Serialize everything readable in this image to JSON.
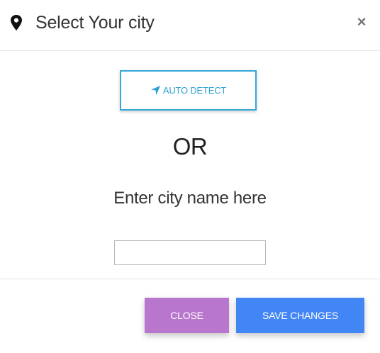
{
  "header": {
    "title": "Select Your city",
    "close_glyph": "×",
    "icon": "map-marker-icon"
  },
  "body": {
    "auto_detect_label": "AUTO DETECT",
    "auto_detect_icon": "location-arrow-icon",
    "or_text": "OR",
    "enter_city_label": "Enter city name here",
    "city_input": {
      "value": "",
      "placeholder": ""
    }
  },
  "footer": {
    "close_label": "CLOSE",
    "save_label": "SAVE CHANGES"
  },
  "colors": {
    "accent_blue": "#35a7d9",
    "close_button": "#b876cc",
    "save_button": "#4285f4"
  }
}
